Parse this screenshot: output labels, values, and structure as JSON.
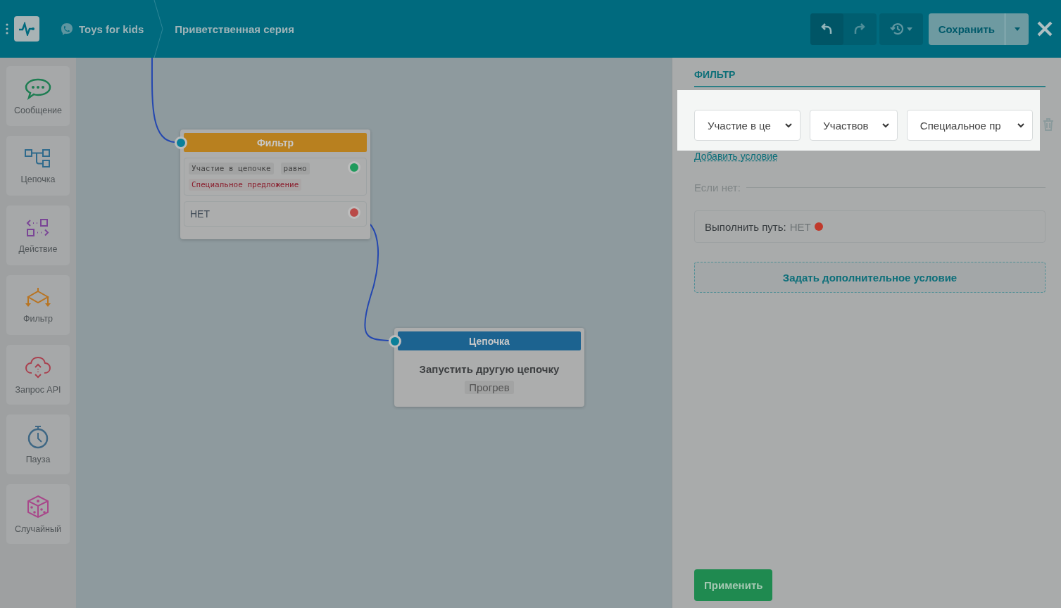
{
  "header": {
    "account": "Toys for kids",
    "breadcrumb": "Приветственная серия",
    "save_button": "Сохранить"
  },
  "sidebar": {
    "items": [
      {
        "kind": "message",
        "label": "Сообщение"
      },
      {
        "kind": "chain",
        "label": "Цепочка"
      },
      {
        "kind": "action",
        "label": "Действие"
      },
      {
        "kind": "filter",
        "label": "Фильтр"
      },
      {
        "kind": "api",
        "label": "Запрос API"
      },
      {
        "kind": "pause",
        "label": "Пауза"
      },
      {
        "kind": "random",
        "label": "Случайный"
      }
    ]
  },
  "canvas": {
    "nodes": [
      {
        "kind": "filter",
        "title": "Фильтр",
        "conditions": [
          {
            "tags": [
              {
                "kind": "field",
                "text": "Участие в цепочке"
              },
              {
                "kind": "operator",
                "text": "равно"
              },
              {
                "kind": "value",
                "text": "Специальное предложение"
              }
            ],
            "color": "#1f9a5c"
          }
        ],
        "else": {
          "label": "НЕТ",
          "color": "#b94a48"
        }
      },
      {
        "kind": "chain",
        "title": "Цепочка",
        "action": "Запустить другую цепочку",
        "value": "Прогрев"
      }
    ]
  },
  "panel": {
    "title": "ФИЛЬТР",
    "selects": [
      {
        "value": "Участие в це"
      },
      {
        "value": "Участвов"
      },
      {
        "value": "Специальное пр"
      }
    ],
    "add_condition": "Добавить условие",
    "else_label": "Если нет:",
    "path": {
      "label": "Выполнить путь:",
      "value": "НЕТ",
      "color": "#c0392b"
    },
    "extra_condition_button": "Задать дополнительное условие",
    "apply_button": "Применить"
  }
}
